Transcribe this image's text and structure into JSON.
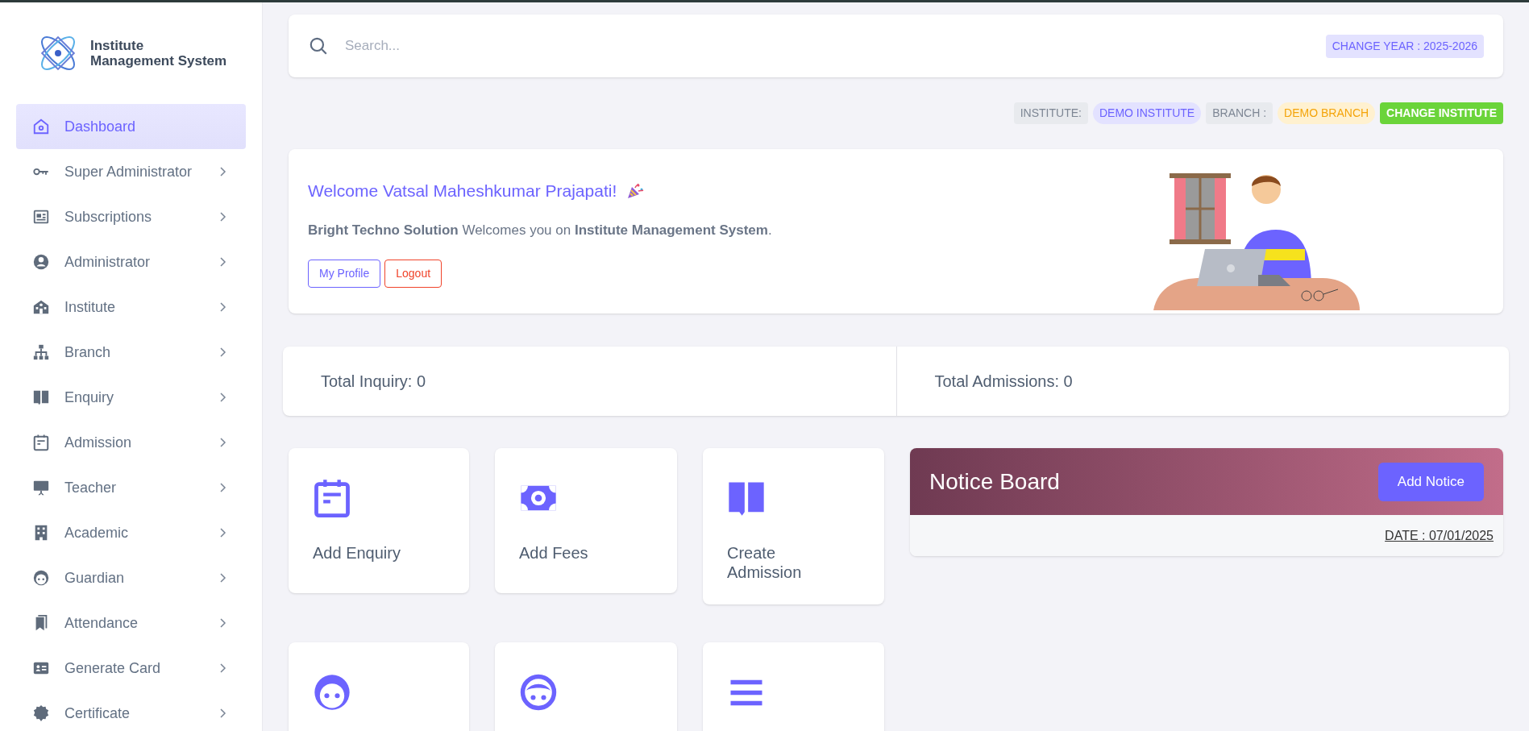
{
  "sidebar": {
    "logo": {
      "line_1": "Institute",
      "line_2": "Management System"
    },
    "items": [
      {
        "label": "Dashboard",
        "selected": true,
        "expandable": false
      },
      {
        "label": "Super Administrator",
        "selected": false,
        "expandable": true
      },
      {
        "label": "Subscriptions",
        "selected": false,
        "expandable": true
      },
      {
        "label": "Administrator",
        "selected": false,
        "expandable": true
      },
      {
        "label": "Institute",
        "selected": false,
        "expandable": true
      },
      {
        "label": "Branch",
        "selected": false,
        "expandable": true
      },
      {
        "label": "Enquiry",
        "selected": false,
        "expandable": true
      },
      {
        "label": "Admission",
        "selected": false,
        "expandable": true
      },
      {
        "label": "Teacher",
        "selected": false,
        "expandable": true
      },
      {
        "label": "Academic",
        "selected": false,
        "expandable": true
      },
      {
        "label": "Guardian",
        "selected": false,
        "expandable": true
      },
      {
        "label": "Attendance",
        "selected": false,
        "expandable": true
      },
      {
        "label": "Generate Card",
        "selected": false,
        "expandable": true
      },
      {
        "label": "Certificate",
        "selected": false,
        "expandable": true
      }
    ]
  },
  "search": {
    "placeholder": "Search..."
  },
  "year_badge": "CHANGE YEAR : 2025-2026",
  "context_badges": [
    {
      "kind": "label",
      "text": "INSTITUTE:"
    },
    {
      "kind": "institute",
      "text": "DEMO INSTITUTE"
    },
    {
      "kind": "label",
      "text": "BRANCH :"
    },
    {
      "kind": "branch",
      "text": "DEMO BRANCH"
    },
    {
      "kind": "action",
      "text": "CHANGE INSTITUTE"
    }
  ],
  "welcome": {
    "title": "Welcome Vatsal Maheshkumar Prajapati!",
    "message": "**Bright Techno Solution** Welcomes you on **Institute Management System**.",
    "buttons": [
      {
        "kind": "primary",
        "label": "My Profile"
      },
      {
        "kind": "danger",
        "label": "Logout"
      }
    ]
  },
  "stats": [
    "Total Inquiry: 0",
    "Total Admissions: 0"
  ],
  "quick_actions": [
    {
      "kind": "shortcut",
      "label": "Add Enquiry"
    },
    {
      "kind": "shortcut",
      "label": "Add Fees"
    },
    {
      "kind": "shortcut",
      "label": "Create Admission"
    },
    {
      "kind": "shortcut"
    },
    {
      "kind": "shortcut"
    },
    {
      "kind": "shortcut"
    }
  ],
  "notice_board": {
    "title": "Notice Board",
    "button": "Add Notice",
    "date": "DATE : 07/01/2025"
  }
}
